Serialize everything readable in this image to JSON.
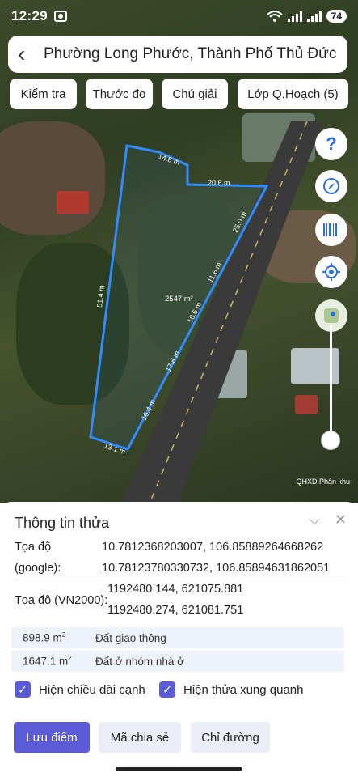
{
  "status_bar": {
    "time": "12:29",
    "battery": "74"
  },
  "header": {
    "title": "Phường Long Phước, Thành Phố Thủ Đức"
  },
  "toolbar": {
    "chips": [
      "Kiểm tra",
      "Thước đo",
      "Chú giải",
      "Lớp Q.Hoạch (5)"
    ]
  },
  "map": {
    "parcel_area": "2547 m²",
    "edges": [
      "14.8 m",
      "20.6 m",
      "25.0 m",
      "11.6 m",
      "16.6 m",
      "17.8 m",
      "16.4 m",
      "13.1 m",
      "51.4 m"
    ],
    "footnote": "QHXD Phân khu",
    "controls": [
      "help-icon",
      "compass-icon",
      "barcode-icon",
      "locate-icon",
      "map-layer-icon"
    ],
    "accent": "#2f8cff"
  },
  "sheet": {
    "title": "Thông tin thửa",
    "coords_label_1": "Tọa độ",
    "coords_label_2": "(google):",
    "google_coord_1": "10.7812368203007, 106.85889264668262",
    "google_coord_2": "10.78123780330732, 106.85894631862051",
    "vn2000_label": "Tọa độ (VN2000):",
    "vn2000_coord_1": "1192480.144, 621075.881",
    "vn2000_coord_2": "1192480.274, 621081.751",
    "land_use": [
      {
        "area": "898.9 m",
        "sup": "2",
        "type": "Đất giao thông"
      },
      {
        "area": "1647.1 m",
        "sup": "2",
        "type": "Đất ở nhóm nhà ở"
      }
    ],
    "check_edges": "Hiện chiều dài cạnh",
    "check_nearby": "Hiện thửa xung quanh",
    "buttons": {
      "save": "Lưu điểm",
      "share": "Mã chia sẻ",
      "directions": "Chỉ đường"
    },
    "primary_color": "#5b5bd6"
  }
}
